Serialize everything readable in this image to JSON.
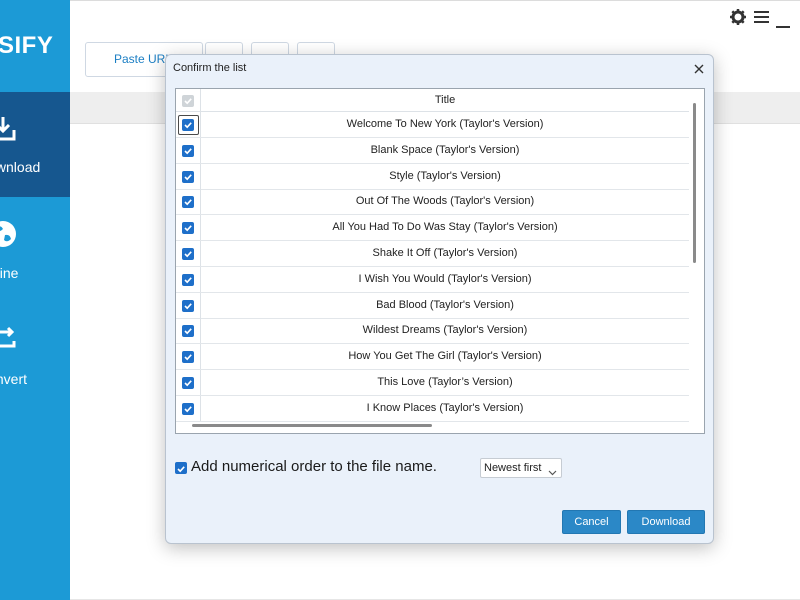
{
  "app": {
    "brand": "SIFY",
    "nav": [
      {
        "label": "Download",
        "icon": "download-icon",
        "active": true
      },
      {
        "label": "Online",
        "icon": "globe-icon",
        "active": false
      },
      {
        "label": "Convert",
        "icon": "convert-icon",
        "active": false
      }
    ],
    "toolbar": {
      "paste_label": "Paste URL",
      "top_icons": [
        "gear-icon",
        "menu-icon",
        "minimize-icon"
      ]
    }
  },
  "dialog": {
    "title": "Confirm the list",
    "column_title": "Title",
    "rows": [
      {
        "title": "Welcome To New York (Taylor's Version)",
        "checked": true
      },
      {
        "title": "Blank Space (Taylor's Version)",
        "checked": true
      },
      {
        "title": "Style (Taylor's Version)",
        "checked": true
      },
      {
        "title": "Out Of The Woods (Taylor's Version)",
        "checked": true
      },
      {
        "title": "All You Had To Do Was Stay (Taylor's Version)",
        "checked": true
      },
      {
        "title": "Shake It Off (Taylor's Version)",
        "checked": true
      },
      {
        "title": "I Wish You Would (Taylor's Version)",
        "checked": true
      },
      {
        "title": "Bad Blood (Taylor's Version)",
        "checked": true
      },
      {
        "title": "Wildest Dreams (Taylor's Version)",
        "checked": true
      },
      {
        "title": "How You Get The Girl (Taylor's Version)",
        "checked": true
      },
      {
        "title": "This Love (Taylor’s Version)",
        "checked": true
      },
      {
        "title": "I Know Places (Taylor's Version)",
        "checked": true
      }
    ],
    "order_option": {
      "label": "Add numerical order to the file name.",
      "checked": true
    },
    "sort": {
      "selected": "Newest first"
    },
    "buttons": {
      "cancel": "Cancel",
      "download": "Download"
    }
  },
  "colors": {
    "sidebar": "#1c9ad6",
    "sidebar_active": "#16578f",
    "accent": "#2b88c7",
    "checkbox": "#1e6fc9"
  }
}
